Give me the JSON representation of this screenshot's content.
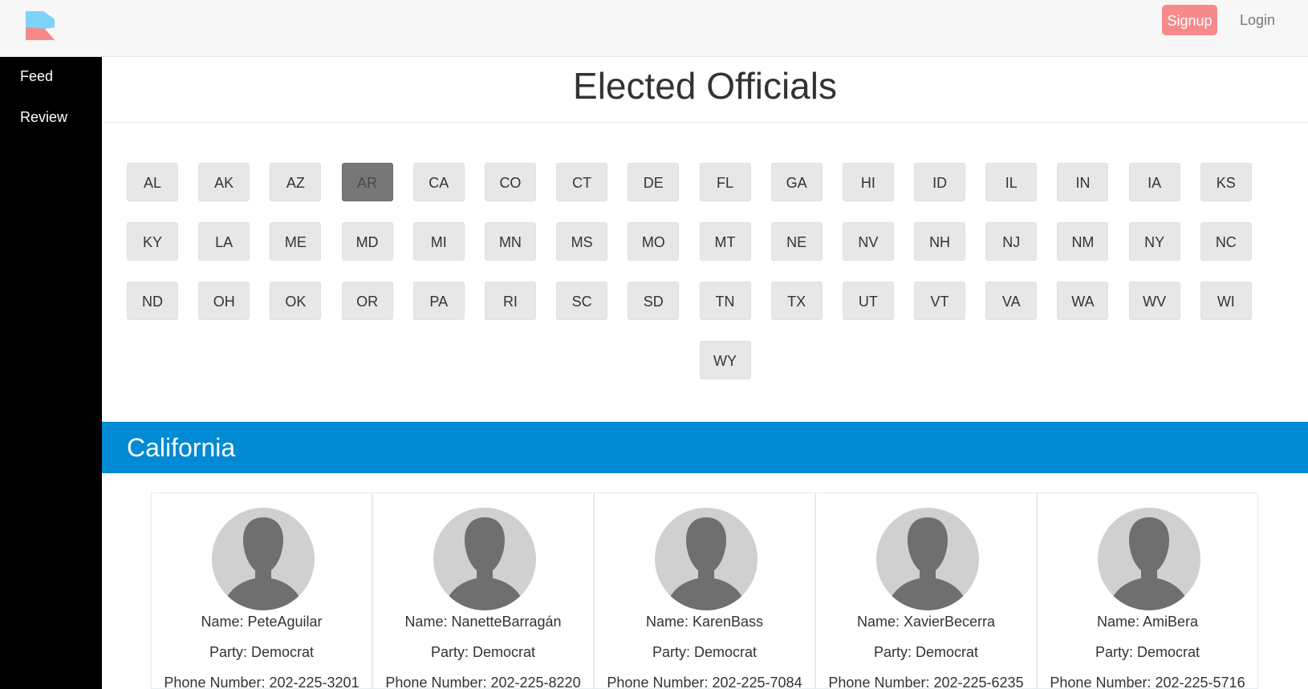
{
  "header": {
    "logo_icon": "app-logo-icon",
    "signup_label": "Signup",
    "login_label": "Login",
    "colors": {
      "signup": "#f8898a",
      "logo_blue": "#7dd3f7",
      "logo_pink": "#f8898a"
    }
  },
  "sidebar": {
    "items": [
      {
        "label": "Feed"
      },
      {
        "label": "Review"
      }
    ]
  },
  "main": {
    "title": "Elected Officials",
    "states": [
      "AL",
      "AK",
      "AZ",
      "AR",
      "CA",
      "CO",
      "CT",
      "DE",
      "FL",
      "GA",
      "HI",
      "ID",
      "IL",
      "IN",
      "IA",
      "KS",
      "KY",
      "LA",
      "ME",
      "MD",
      "MI",
      "MN",
      "MS",
      "MO",
      "MT",
      "NE",
      "NV",
      "NH",
      "NJ",
      "NM",
      "NY",
      "NC",
      "ND",
      "OH",
      "OK",
      "OR",
      "PA",
      "RI",
      "SC",
      "SD",
      "TN",
      "TX",
      "UT",
      "VT",
      "VA",
      "WA",
      "WV",
      "WI",
      "WY"
    ],
    "active_state": "AR",
    "selected_state_name": "California",
    "banner_color": "#028ad4",
    "officials": [
      {
        "name": "Name: PeteAguilar",
        "party": "Party: Democrat",
        "phone": "Phone Number: 202-225-3201",
        "avatar_icon": "person-avatar-icon"
      },
      {
        "name": "Name: NanetteBarragán",
        "party": "Party: Democrat",
        "phone": "Phone Number: 202-225-8220",
        "avatar_icon": "person-avatar-icon"
      },
      {
        "name": "Name: KarenBass",
        "party": "Party: Democrat",
        "phone": "Phone Number: 202-225-7084",
        "avatar_icon": "person-avatar-icon"
      },
      {
        "name": "Name: XavierBecerra",
        "party": "Party: Democrat",
        "phone": "Phone Number: 202-225-6235",
        "avatar_icon": "person-avatar-icon"
      },
      {
        "name": "Name: AmiBera",
        "party": "Party: Democrat",
        "phone": "Phone Number: 202-225-5716",
        "avatar_icon": "person-avatar-icon"
      }
    ]
  }
}
